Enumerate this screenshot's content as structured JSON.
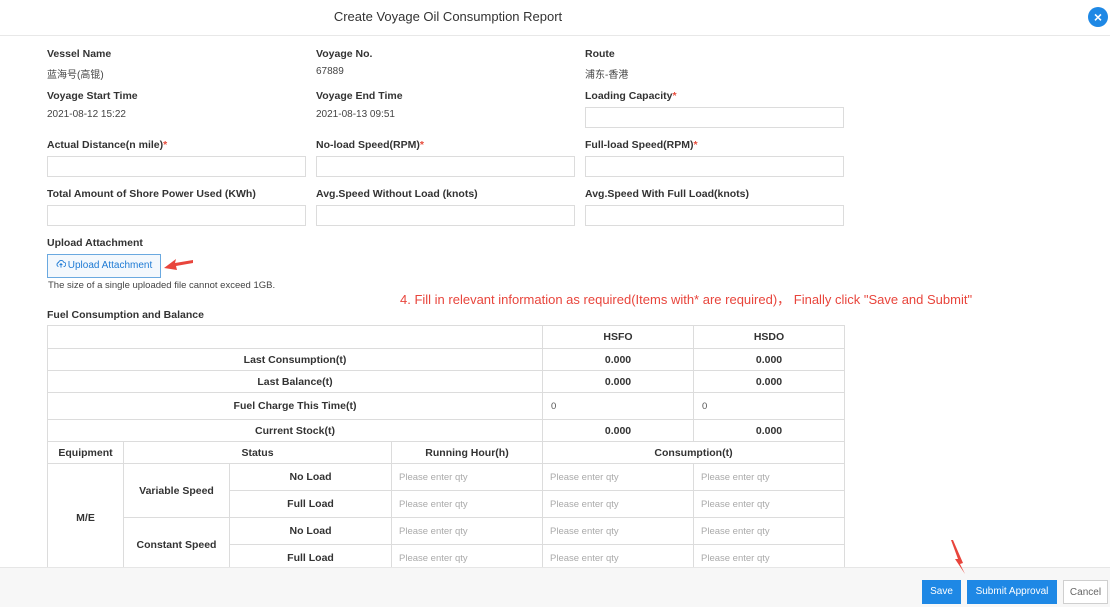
{
  "header": {
    "title": "Create Voyage Oil Consumption Report",
    "close_icon": "×"
  },
  "fields": {
    "vessel_name": {
      "label": "Vessel Name",
      "value": "蓝海号(高锟)"
    },
    "voyage_no": {
      "label": "Voyage No.",
      "value": "67889"
    },
    "route": {
      "label": "Route",
      "value": "浦东-香港"
    },
    "voyage_start": {
      "label": "Voyage Start Time",
      "value": "2021-08-12 15:22"
    },
    "voyage_end": {
      "label": "Voyage End Time",
      "value": "2021-08-13 09:51"
    },
    "loading_capacity": {
      "label": "Loading Capacity",
      "required": "*"
    },
    "actual_distance": {
      "label": "Actual Distance(n mile)",
      "required": "*"
    },
    "noload_speed": {
      "label": "No-load Speed(RPM)",
      "required": "*"
    },
    "fullload_speed": {
      "label": "Full-load Speed(RPM)",
      "required": "*"
    },
    "shore_power": {
      "label": "Total Amount of Shore Power Used (KWh)"
    },
    "avg_speed_noload": {
      "label": "Avg.Speed Without Load (knots)"
    },
    "avg_speed_full": {
      "label": "Avg.Speed With Full Load(knots)"
    }
  },
  "upload": {
    "label": "Upload Attachment",
    "button": "Upload Attachment",
    "icon": "cloud-upload-icon",
    "note": "The size of a single uploaded file cannot exceed 1GB."
  },
  "annotation": "4. Fill in relevant information as required(Items with* are required)，  Finally click \"Save and Submit\"",
  "fuel": {
    "title": "Fuel Consumption and Balance",
    "col_hsfo": "HSFO",
    "col_hsdo": "HSDO",
    "rows": {
      "last_consumption": {
        "label": "Last Consumption(t)",
        "hsfo": "0.000",
        "hsdo": "0.000"
      },
      "last_balance": {
        "label": "Last Balance(t)",
        "hsfo": "0.000",
        "hsdo": "0.000"
      },
      "fuel_charge": {
        "label": "Fuel Charge This Time(t)",
        "hsfo": "0",
        "hsdo": "0"
      },
      "current_stock": {
        "label": "Current Stock(t)",
        "hsfo": "0.000",
        "hsdo": "0.000"
      }
    },
    "equip_header": {
      "equipment": "Equipment",
      "status": "Status",
      "running_hour": "Running Hour(h)",
      "consumption": "Consumption(t)"
    },
    "equipment_name": "M/E",
    "variable_speed": "Variable Speed",
    "constant_speed": "Constant Speed",
    "no_load": "No Load",
    "full_load": "Full Load",
    "placeholder": "Please enter qty"
  },
  "footer": {
    "save": "Save",
    "submit": "Submit Approval",
    "cancel": "Cancel"
  },
  "colors": {
    "accent": "#1e88e5",
    "annotation": "#e8453c",
    "required": "#e74c3c"
  }
}
